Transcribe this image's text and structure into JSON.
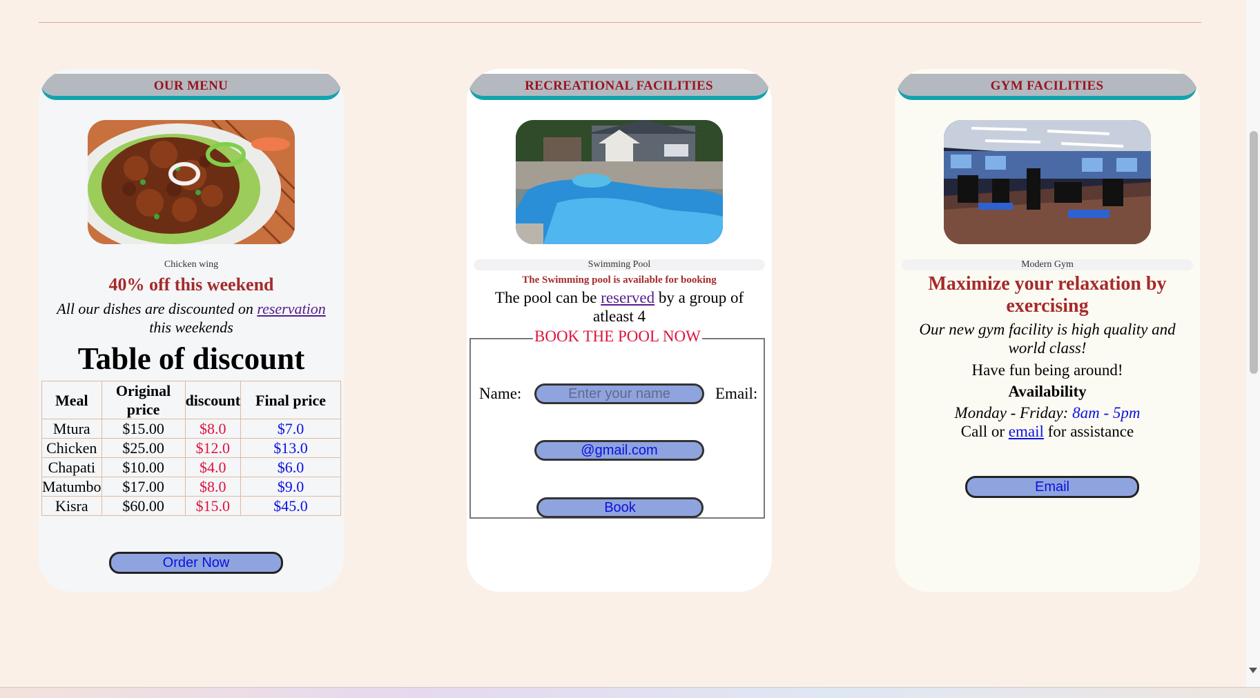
{
  "menu": {
    "header": "OUR MENU",
    "caption": "Chicken wing",
    "promo": "40% off this weekend",
    "desc_before": "All our dishes are discounted on",
    "desc_link": "reservation",
    "desc_after": "this weekends",
    "table_title": "Table of discount",
    "table": {
      "headers": [
        "Meal",
        "Original price",
        "discount",
        "Final price"
      ],
      "rows": [
        [
          "Mtura",
          "$15.00",
          "$8.0",
          "$7.0"
        ],
        [
          "Chicken",
          "$25.00",
          "$12.0",
          "$13.0"
        ],
        [
          "Chapati",
          "$10.00",
          "$4.0",
          "$6.0"
        ],
        [
          "Matumbo",
          "$17.00",
          "$8.0",
          "$9.0"
        ],
        [
          "Kisra",
          "$60.00",
          "$15.0",
          "$45.0"
        ]
      ]
    },
    "button": "Order Now"
  },
  "pool": {
    "header": "RECREATIONAL FACILITIES",
    "caption": "Swimming Pool",
    "availability": "The Swimming pool is available for booking",
    "text_before": "The pool can be",
    "text_link": "reserved",
    "text_after": "by a group of atleast 4",
    "form": {
      "legend": "BOOK THE POOL NOW",
      "name_label": "Name:",
      "name_placeholder": "Enter your name",
      "email_label": "Email:",
      "email_value": "@gmail.com",
      "submit": "Book"
    }
  },
  "gym": {
    "header": "GYM FACILITIES",
    "caption": "Modern Gym",
    "headline": "Maximize your relaxation by exercising",
    "tagline": "Our new gym facility is high quality and world class!",
    "fun": "Have fun being around!",
    "availability_label": "Availability",
    "days": "Monday - Friday:",
    "hours": "8am - 5pm",
    "call_before": "Call or",
    "call_link": "email",
    "call_after": "for assistance",
    "button": "Email"
  },
  "colors": {
    "page_bg": "#faf0e8",
    "header_text": "#9b1320",
    "header_underline": "#13a3ad",
    "promo": "#a52a2a",
    "discount": "#e0113a",
    "final": "#0b10e0",
    "button_bg": "#8fa4de"
  }
}
